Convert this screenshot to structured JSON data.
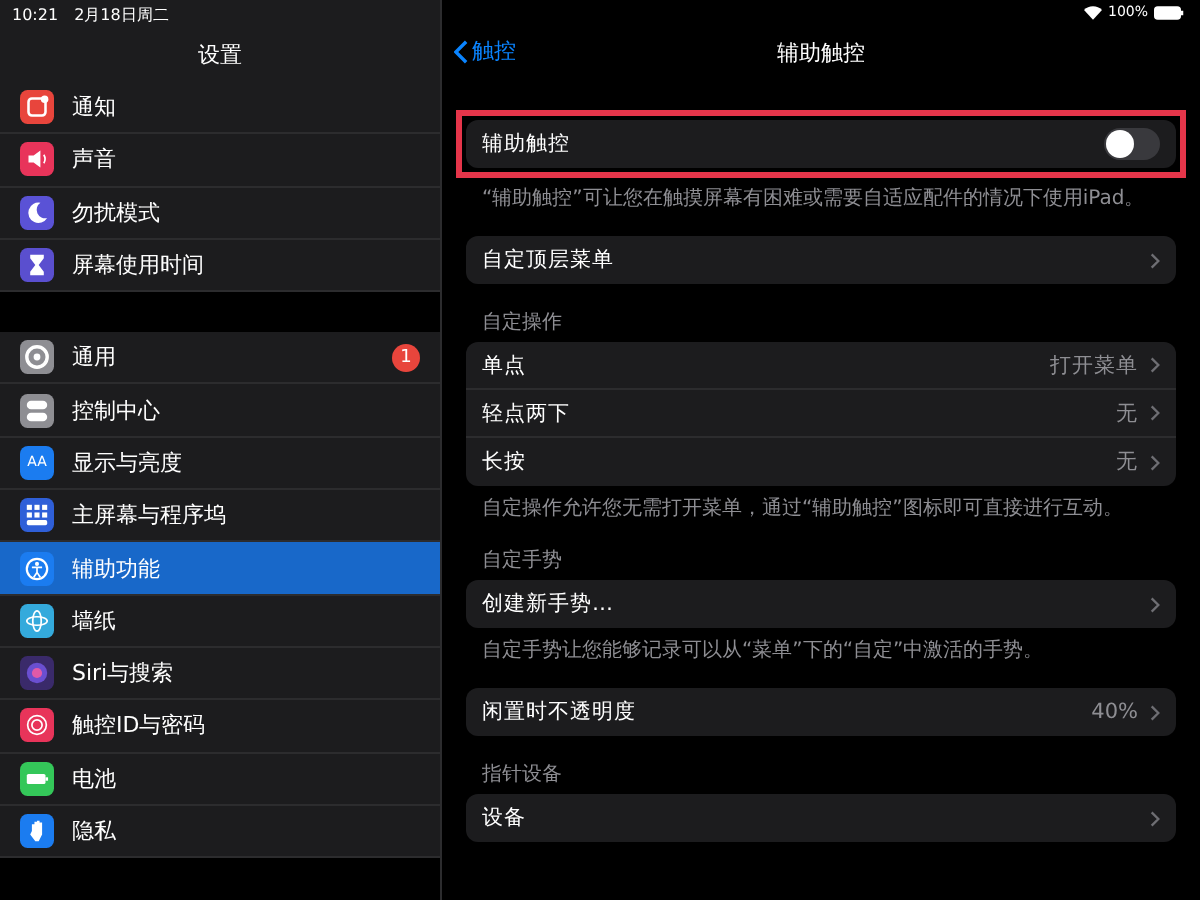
{
  "status_bar": {
    "time": "10:21",
    "date": "2月18日周二",
    "battery": "100%"
  },
  "sidebar": {
    "title": "设置",
    "groups": [
      [
        {
          "label": "通知",
          "color": "#e8453c",
          "selected": false
        },
        {
          "label": "声音",
          "color": "#e8345a",
          "selected": false
        },
        {
          "label": "勿扰模式",
          "color": "#5a52d6",
          "selected": false
        },
        {
          "label": "屏幕使用时间",
          "color": "#5a4fcf",
          "selected": false
        }
      ],
      [
        {
          "label": "通用",
          "color": "#8e8e93",
          "selected": false,
          "badge": "1"
        },
        {
          "label": "控制中心",
          "color": "#8e8e93",
          "selected": false
        },
        {
          "label": "显示与亮度",
          "color": "#1b7cf0",
          "selected": false,
          "icon_text": "AA"
        },
        {
          "label": "主屏幕与程序坞",
          "color": "#2f5fd8",
          "selected": false
        },
        {
          "label": "辅助功能",
          "color": "#1b7cf0",
          "selected": true
        },
        {
          "label": "墙纸",
          "color": "#34aadc",
          "selected": false
        },
        {
          "label": "Siri与搜索",
          "color": "#3a2a6a",
          "selected": false
        },
        {
          "label": "触控ID与密码",
          "color": "#e8345a",
          "selected": false
        },
        {
          "label": "电池",
          "color": "#34c759",
          "selected": false
        },
        {
          "label": "隐私",
          "color": "#1b7cf0",
          "selected": false
        }
      ]
    ]
  },
  "detail": {
    "back": "触控",
    "title": "辅助触控",
    "sections": [
      {
        "rows": [
          {
            "kind": "toggle",
            "label": "辅助触控",
            "on": false,
            "highlighted": true
          }
        ],
        "footer": "“辅助触控”可让您在触摸屏幕有困难或需要自适应配件的情况下使用iPad。"
      },
      {
        "rows": [
          {
            "kind": "link",
            "label": "自定顶层菜单"
          }
        ]
      },
      {
        "header": "自定操作",
        "rows": [
          {
            "kind": "link",
            "label": "单点",
            "value": "打开菜单"
          },
          {
            "kind": "link",
            "label": "轻点两下",
            "value": "无"
          },
          {
            "kind": "link",
            "label": "长按",
            "value": "无"
          }
        ],
        "footer": "自定操作允许您无需打开菜单，通过“辅助触控”图标即可直接进行互动。"
      },
      {
        "header": "自定手势",
        "rows": [
          {
            "kind": "link",
            "label": "创建新手势…"
          }
        ],
        "footer": "自定手势让您能够记录可以从“菜单”下的“自定”中激活的手势。"
      },
      {
        "rows": [
          {
            "kind": "link",
            "label": "闲置时不透明度",
            "value": "40%"
          }
        ]
      },
      {
        "header": "指针设备",
        "rows": [
          {
            "kind": "link",
            "label": "设备"
          }
        ]
      }
    ]
  }
}
